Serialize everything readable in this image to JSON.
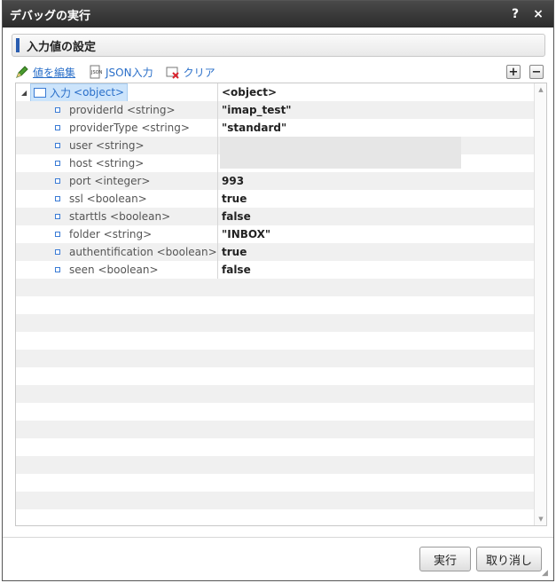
{
  "window": {
    "title": "デバッグの実行",
    "help_label": "?",
    "close_label": "×"
  },
  "section": {
    "title": "入力値の設定"
  },
  "toolbar": {
    "edit_label": "値を編集",
    "json_label": "JSON入力",
    "clear_label": "クリア",
    "expand_label": "+",
    "collapse_label": "−"
  },
  "tree": {
    "root": {
      "name": "入力",
      "type": "<object>",
      "value": "<object>"
    },
    "rows": [
      {
        "key": "providerId <string>",
        "value": "\"imap_test\""
      },
      {
        "key": "providerType <string>",
        "value": "\"standard\""
      },
      {
        "key": "user <string>",
        "value": ""
      },
      {
        "key": "host <string>",
        "value": ""
      },
      {
        "key": "port <integer>",
        "value": "993"
      },
      {
        "key": "ssl <boolean>",
        "value": "true"
      },
      {
        "key": "starttls <boolean>",
        "value": "false"
      },
      {
        "key": "folder <string>",
        "value": "\"INBOX\""
      },
      {
        "key": "authentification <boolean>",
        "value": "true"
      },
      {
        "key": "seen <boolean>",
        "value": "false"
      }
    ]
  },
  "footer": {
    "run_label": "実行",
    "cancel_label": "取り消し"
  },
  "colors": {
    "accent": "#2a5db0",
    "link": "#2a6fc9",
    "selection": "#cce4fb"
  }
}
